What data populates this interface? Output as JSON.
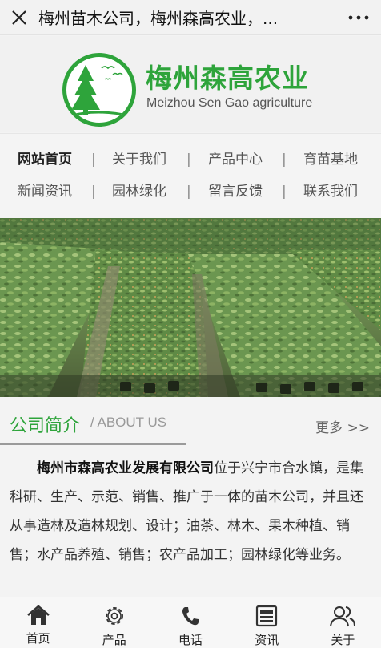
{
  "topbar": {
    "title": "梅州苗木公司，梅州森高农业，...",
    "close_icon": "close-icon",
    "more_icon": "more-dots-icon"
  },
  "logo": {
    "title": "梅州森高农业",
    "subtitle": "Meizhou Sen Gao agriculture",
    "brand_color": "#2ea43b"
  },
  "nav": {
    "row1": [
      "网站首页",
      "关于我们",
      "产品中心",
      "育苗基地"
    ],
    "row2": [
      "新闻资讯",
      "园林绿化",
      "留言反馈",
      "联系我们"
    ],
    "separator": "|"
  },
  "section": {
    "title": "公司简介",
    "subtitle": "/ ABOUT US",
    "more": "更多 >>"
  },
  "intro": {
    "company": "梅州市森高农业发展有限公司",
    "text": "位于兴宁市合水镇，是集科研、生产、示范、销售、推广于一体的苗木公司，并且还从事造林及造林规划、设计；油茶、林木、果木种植、销售；水产品养殖、销售；农产品加工；园林绿化等业务。"
  },
  "tabbar": {
    "items": [
      {
        "label": "首页",
        "icon": "home-icon"
      },
      {
        "label": "产品",
        "icon": "gear-icon"
      },
      {
        "label": "电话",
        "icon": "phone-icon"
      },
      {
        "label": "资讯",
        "icon": "news-icon"
      },
      {
        "label": "关于",
        "icon": "users-icon"
      }
    ]
  }
}
